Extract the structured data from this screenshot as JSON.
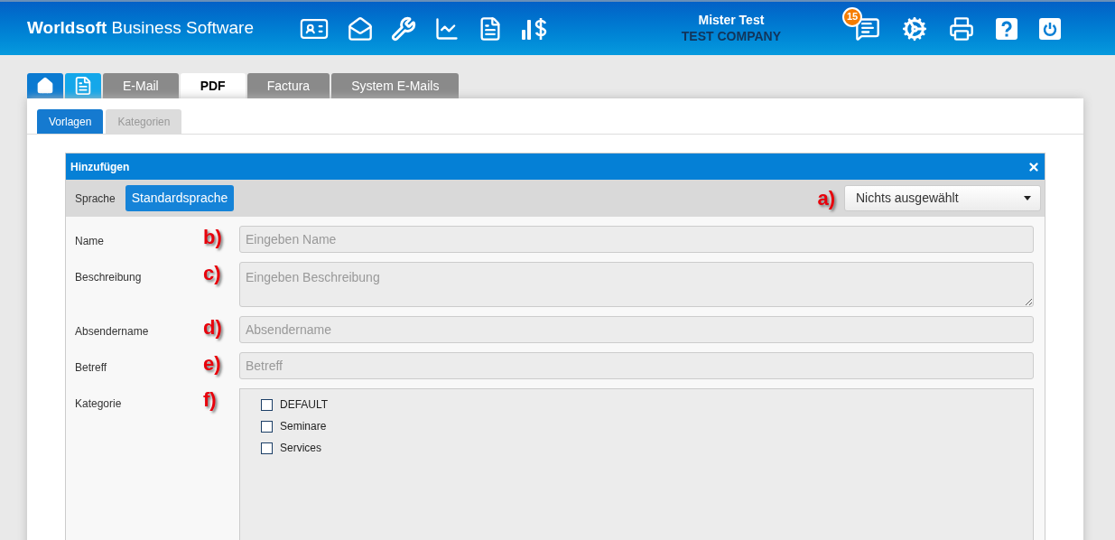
{
  "header": {
    "brand_bold": "Worldsoft",
    "brand_rest": "Business Software",
    "user_name": "Mister Test",
    "company": "TEST COMPANY",
    "notification_count": "15"
  },
  "tabs": [
    {
      "kind": "home",
      "selected": false
    },
    {
      "kind": "document",
      "selected": false
    },
    {
      "kind": "text",
      "label": "E-Mail",
      "selected": false
    },
    {
      "kind": "text",
      "label": "PDF",
      "selected": true
    },
    {
      "kind": "text",
      "label": "Factura",
      "selected": false
    },
    {
      "kind": "text",
      "label": "System E-Mails",
      "selected": false
    }
  ],
  "subtabs": [
    {
      "label": "Vorlagen",
      "selected": true
    },
    {
      "label": "Kategorien",
      "selected": false
    }
  ],
  "dialog": {
    "title": "Hinzufügen",
    "toolbar": {
      "language_label": "Sprache",
      "language_button": "Standardsprache",
      "marker": "a)",
      "dropdown_value": "Nichts ausgewählt"
    },
    "fields": [
      {
        "kind": "input",
        "label": "Name",
        "marker": "b)",
        "placeholder": "Eingeben Name"
      },
      {
        "kind": "textarea",
        "label": "Beschreibung",
        "marker": "c)",
        "placeholder": "Eingeben Beschreibung"
      },
      {
        "kind": "input",
        "label": "Absendername",
        "marker": "d)",
        "placeholder": "Absendername"
      },
      {
        "kind": "input",
        "label": "Betreff",
        "marker": "e)",
        "placeholder": "Betreff"
      },
      {
        "kind": "checklist",
        "label": "Kategorie",
        "marker": "f)",
        "options": [
          {
            "label": "DEFAULT",
            "checked": false
          },
          {
            "label": "Seminare",
            "checked": false
          },
          {
            "label": "Services",
            "checked": false
          }
        ]
      }
    ]
  }
}
